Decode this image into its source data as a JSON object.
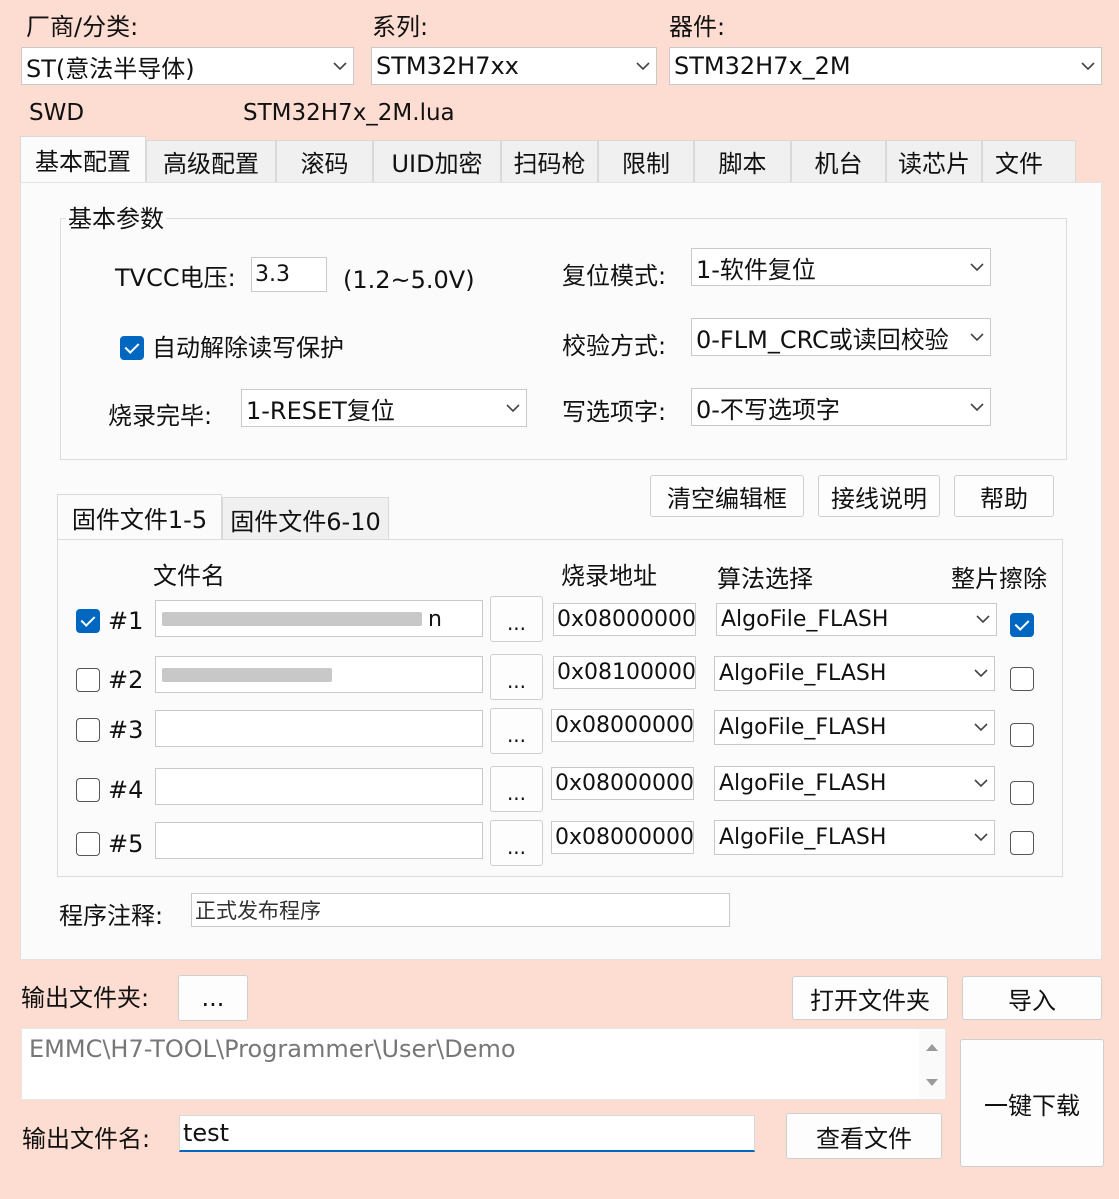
{
  "top": {
    "vendor_label": "厂商/分类:",
    "vendor_value": "ST(意法半导体)",
    "series_label": "系列:",
    "series_value": "STM32H7xx",
    "device_label": "器件:",
    "device_value": "STM32H7x_2M",
    "interface": "SWD",
    "lua_file": "STM32H7x_2M.lua"
  },
  "tabs": [
    "基本配置",
    "高级配置",
    "滚码",
    "UID加密",
    "扫码枪",
    "限制",
    "脚本",
    "机台",
    "读芯片",
    "文件"
  ],
  "basic": {
    "group_title": "基本参数",
    "tvcc_label": "TVCC电压:",
    "tvcc_value": "3.3",
    "tvcc_range": "(1.2~5.0V)",
    "auto_unlock_label": "自动解除读写保护",
    "auto_unlock_checked": true,
    "finish_label": "烧录完毕:",
    "finish_value": "1-RESET复位",
    "reset_mode_label": "复位模式:",
    "reset_mode_value": "1-软件复位",
    "verify_label": "校验方式:",
    "verify_value": "0-FLM_CRC或读回校验",
    "option_label": "写选项字:",
    "option_value": "0-不写选项字"
  },
  "buttons": {
    "clear": "清空编辑框",
    "wiring": "接线说明",
    "help": "帮助"
  },
  "file_tabs": [
    "固件文件1-5",
    "固件文件6-10"
  ],
  "file_table": {
    "headers": {
      "name": "文件名",
      "addr": "烧录地址",
      "algo": "算法选择",
      "erase": "整片擦除"
    },
    "browse": "...",
    "rows": [
      {
        "id": "#1",
        "checked": true,
        "name_suffix": "n",
        "addr": "0x08000000",
        "algo": "AlgoFile_FLASH",
        "erase": true
      },
      {
        "id": "#2",
        "checked": false,
        "name_suffix": "",
        "addr": "0x08100000",
        "algo": "AlgoFile_FLASH",
        "erase": false
      },
      {
        "id": "#3",
        "checked": false,
        "name_suffix": "",
        "addr": "0x08000000",
        "algo": "AlgoFile_FLASH",
        "erase": false
      },
      {
        "id": "#4",
        "checked": false,
        "name_suffix": "",
        "addr": "0x08000000",
        "algo": "AlgoFile_FLASH",
        "erase": false
      },
      {
        "id": "#5",
        "checked": false,
        "name_suffix": "",
        "addr": "0x08000000",
        "algo": "AlgoFile_FLASH",
        "erase": false
      }
    ]
  },
  "comment": {
    "label": "程序注释:",
    "value": "正式发布程序"
  },
  "output": {
    "folder_label": "输出文件夹:",
    "folder_browse": "...",
    "open_folder": "打开文件夹",
    "import": "导入",
    "path": "EMMC\\H7-TOOL\\Programmer\\User\\Demo",
    "filename_label": "输出文件名:",
    "filename_value": "test",
    "view_file": "查看文件",
    "one_click": "一键下载"
  },
  "colors": {
    "background": "#fddcd1",
    "checkbox": "#0067c0"
  }
}
